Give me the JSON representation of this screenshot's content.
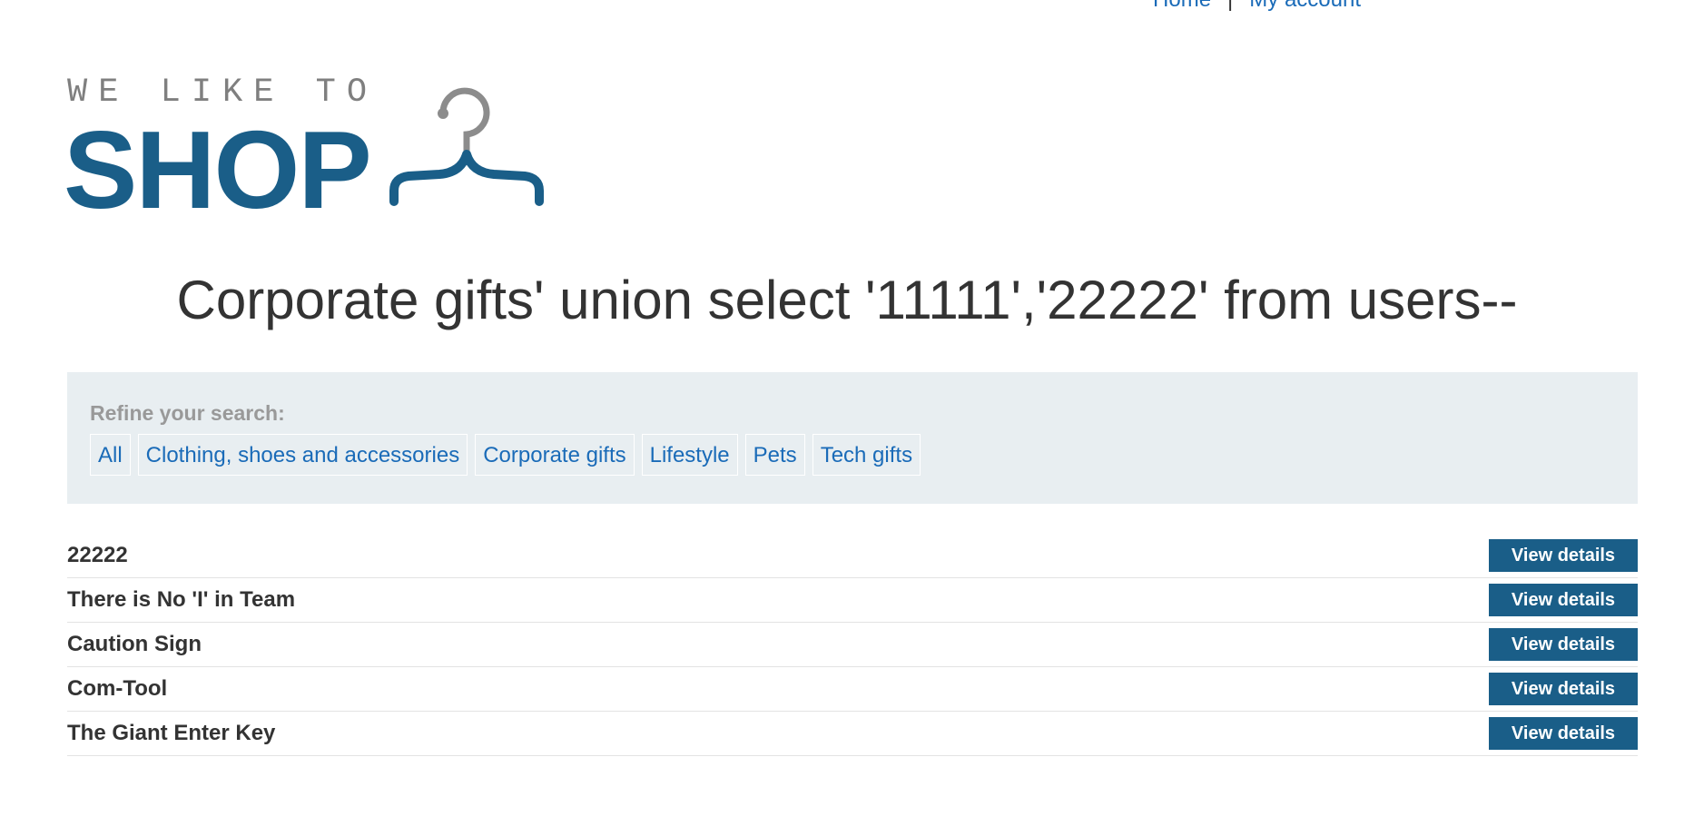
{
  "nav": {
    "home": "Home",
    "separator": "|",
    "account": "My account"
  },
  "logo": {
    "tagline": "WE LIKE TO",
    "wordmark": "SHOP",
    "icon": "hanger-icon",
    "colors": {
      "wordmark": "#1a5e88",
      "tagline": "#7f7f7f"
    }
  },
  "page_title": "Corporate gifts' union select '11111','22222' from users--",
  "filter": {
    "label": "Refine your search:",
    "categories": [
      "All",
      "Clothing, shoes and accessories",
      "Corporate gifts",
      "Lifestyle",
      "Pets",
      "Tech gifts"
    ]
  },
  "products": [
    {
      "name": "22222",
      "button": "View details"
    },
    {
      "name": "There is No 'I' in Team",
      "button": "View details"
    },
    {
      "name": "Caution Sign",
      "button": "View details"
    },
    {
      "name": "Com-Tool",
      "button": "View details"
    },
    {
      "name": "The Giant Enter Key",
      "button": "View details"
    }
  ],
  "colors": {
    "accent": "#1a5e88",
    "link": "#1a6bb8",
    "panel": "#e8eef1",
    "text": "#333333"
  }
}
